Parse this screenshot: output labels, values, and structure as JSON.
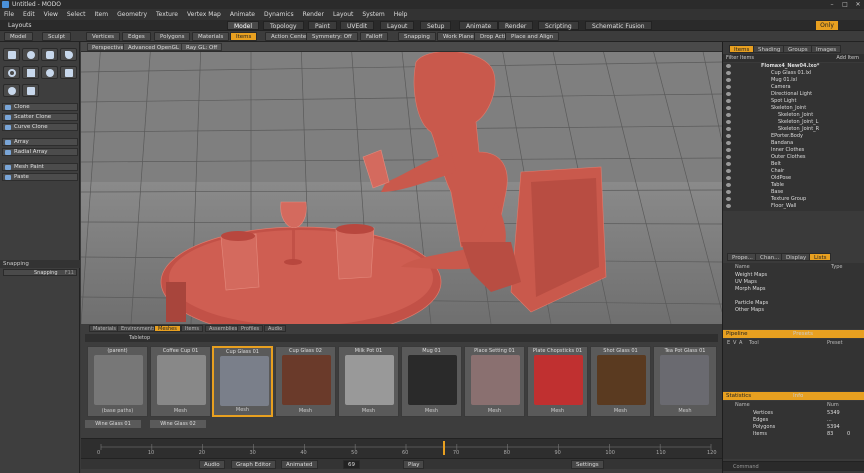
{
  "window": {
    "title": "Untitled - MODO",
    "min": "–",
    "max": "□",
    "close": "✕"
  },
  "menu": [
    "File",
    "Edit",
    "View",
    "Select",
    "Item",
    "Geometry",
    "Texture",
    "Vertex Map",
    "Animate",
    "Dynamics",
    "Render",
    "Layout",
    "System",
    "Help"
  ],
  "layouts_label": "Layouts",
  "layout_tabs": [
    "Model",
    "Topology",
    "Paint",
    "UVEdit",
    "Layout",
    "Setup",
    "Animate",
    "Render",
    "Scripting",
    "Schematic Fusion"
  ],
  "only_label": "Only",
  "mode_bar": {
    "left": [
      "Model",
      "Sculpt"
    ],
    "selection": [
      "Vertices",
      "Edges",
      "Polygons",
      "Materials",
      "Items"
    ],
    "action_center": "Action Center",
    "symmetry": "Symmetry: Off",
    "falloff": "Falloff",
    "snapping": "Snapping",
    "work_plane": "Work Plane",
    "drop_action": "Drop Action",
    "place_align": "Place and Align"
  },
  "left_tools": [
    "Clone",
    "Scatter Clone",
    "Curve Clone",
    "Array",
    "Radial Array",
    "Mesh Paint",
    "Paste"
  ],
  "snapping_label": "Snapping",
  "snapping_button": "Snapping",
  "snapping_key": "F11",
  "viewport_bar": [
    "Perspective",
    "Advanced OpenGL",
    "Ray GL: Off"
  ],
  "right_tabs": [
    "Items",
    "Shading",
    "Groups",
    "Images"
  ],
  "filter_items": "Filter Items",
  "add_item": "Add Item",
  "scene_items": [
    "Flomax4_New04.lxo*",
    "Cup Glass 01.lxl",
    "Mug 01.lxl",
    "Camera",
    "Directional Light",
    "Spot Light",
    "Skeleton_Joint",
    "Skeleton_Joint",
    "Skeleton_Joint_L",
    "Skeleton_Joint_R",
    "EPorter.Body",
    "Bandana",
    "Inner Clothes",
    "Outer Clothes",
    "Belt",
    "Chair",
    "OldPose",
    "Table",
    "Base",
    "Texture Group",
    "Floor_Wall"
  ],
  "right_tabs2": [
    "Prope...",
    "Chan...",
    "Display",
    "Lists"
  ],
  "lists_cols": [
    "Name",
    "Type"
  ],
  "lists_items": [
    "Weight Maps",
    "UV Maps",
    "Morph Maps",
    "",
    "Particle Maps",
    "Other Maps"
  ],
  "pipeline_label": "Pipeline",
  "presets_label": "Presets",
  "pipeline_cols": [
    "E",
    "V",
    "A",
    "Tool",
    "Preset"
  ],
  "statistics_label": "Statistics",
  "info_label": "Info",
  "stats_cols": [
    "Name",
    "Num"
  ],
  "stats": [
    {
      "name": "Vertices",
      "num": "5349"
    },
    {
      "name": "Edges",
      "num": "..."
    },
    {
      "name": "Polygons",
      "num": "5394"
    },
    {
      "name": "Items",
      "num": "83"
    }
  ],
  "stats_extra": "0",
  "asset_tabs": [
    "Materials",
    "Environments",
    "Meshes",
    "Items",
    "Assemblies",
    "Profiles",
    "Audio"
  ],
  "asset_path": "Tabletop",
  "tiles": [
    {
      "label": "(parent)",
      "sub": "(base paths)"
    },
    {
      "label": "Coffee Cup 01",
      "sub": "Mesh"
    },
    {
      "label": "Cup Glass 01",
      "sub": "Mesh"
    },
    {
      "label": "Cup Glass 02",
      "sub": "Mesh"
    },
    {
      "label": "Milk Pot 01",
      "sub": "Mesh"
    },
    {
      "label": "Mug 01",
      "sub": "Mesh"
    },
    {
      "label": "Place Setting 01",
      "sub": "Mesh"
    },
    {
      "label": "Plate Chopsticks 01",
      "sub": "Mesh"
    },
    {
      "label": "Shot Glass 01",
      "sub": "Mesh"
    },
    {
      "label": "Tea Pot Glass 01",
      "sub": "Mesh"
    }
  ],
  "tiles_row2": [
    "Wine Glass 01",
    "Wine Glass 02"
  ],
  "timeline_ticks": [
    "0",
    "10",
    "20",
    "30",
    "40",
    "50",
    "60",
    "70",
    "80",
    "90",
    "100",
    "110",
    "120"
  ],
  "bottom": {
    "audio": "Audio",
    "graph_editor": "Graph Editor",
    "animated": "Animated",
    "frame": "69",
    "play": "Play",
    "settings": "Settings"
  },
  "command_label": "Command",
  "colors": {
    "accent": "#e8a020",
    "model": "#c9594c",
    "grid_bg": "#7d7d7d"
  }
}
